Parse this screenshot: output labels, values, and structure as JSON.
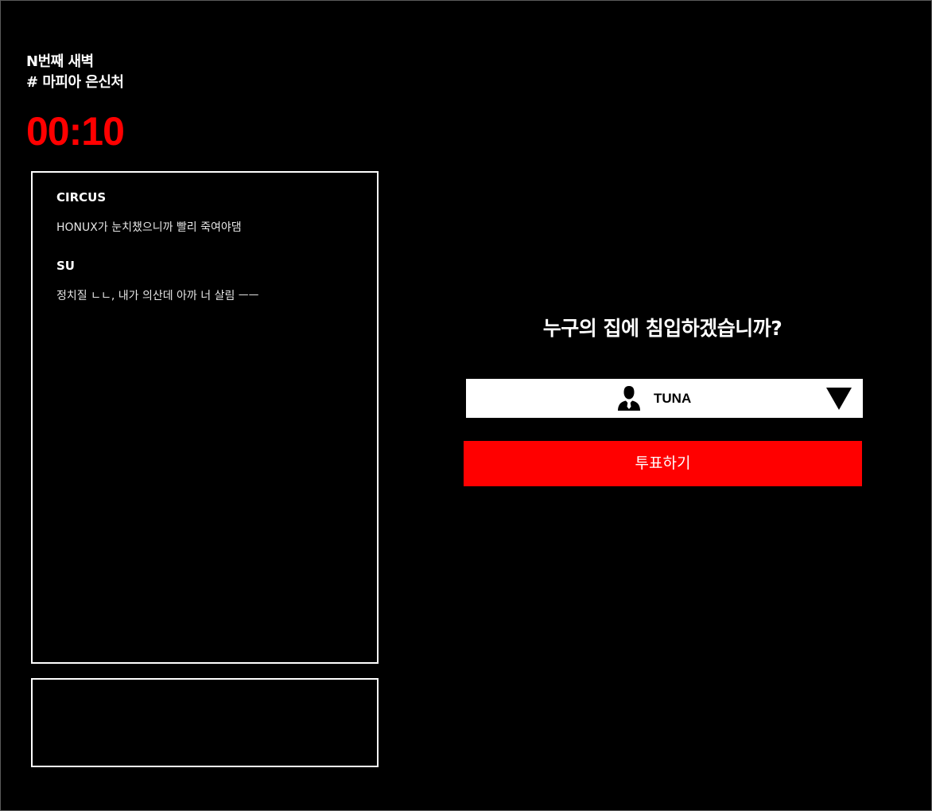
{
  "header": {
    "phase_title": "N번째 새벽",
    "location_title": "# 마피아 은신처"
  },
  "timer": {
    "value": "00:10",
    "color": "#ff0000"
  },
  "chat": {
    "messages": [
      {
        "author": "CIRCUS",
        "text": "HONUX가 눈치챘으니까 빨리 죽여야댐"
      },
      {
        "author": "SU",
        "text": "정치질 ㄴㄴ, 내가 의산데 아까 너 살림 ㅡㅡ"
      }
    ],
    "input_value": ""
  },
  "vote": {
    "question": "누구의 집에 침입하겠습니까?",
    "selected_player": "TUNA",
    "player_icon": "person-icon",
    "dropdown_icon": "caret-down-icon",
    "button_label": "투표하기",
    "button_color": "#ff0000"
  }
}
